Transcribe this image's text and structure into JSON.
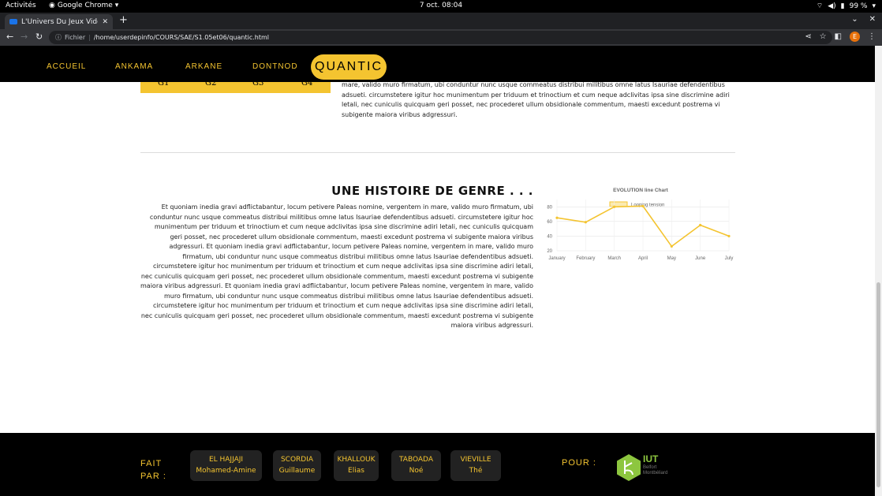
{
  "system": {
    "activities": "Activités",
    "app_name": "Google Chrome",
    "clock": "7 oct.  08:04",
    "battery": "99 %"
  },
  "browser": {
    "tab_title": "L'Univers Du Jeux Vidéo F",
    "url_prefix": "Fichier",
    "url": "/home/userdepinfo/COURS/SAE/S1.05et06/quantic.html",
    "profile_initial": "E"
  },
  "nav": {
    "items": [
      "ACCUEIL",
      "ANKAMA",
      "ARKANE",
      "DONTNOD"
    ],
    "active": "QUANTIC"
  },
  "top_table": {
    "headers": [
      "G1",
      "G2",
      "G3",
      "G4"
    ]
  },
  "top_paragraph": "mare, valido muro firmatum, ubi conduntur nunc usque commeatus distribui militibus omne latus Isauriae defendentibus adsueti. circumstetere igitur hoc munimentum per triduum et trinoctium et cum neque adclivitas ipsa sine discrimine adiri letali, nec cuniculis quicquam geri posset, nec procederet ullum obsidionale commentum, maesti excedunt postrema vi subigente maiora viribus adgressuri.",
  "section": {
    "title": "UNE HISTOIRE DE GENRE . . .",
    "paragraph": "Et quoniam inedia gravi adflictabantur, locum petivere Paleas nomine, vergentem in mare, valido muro firmatum, ubi conduntur nunc usque commeatus distribui militibus omne latus Isauriae defendentibus adsueti. circumstetere igitur hoc munimentum per triduum et trinoctium et cum neque adclivitas ipsa sine discrimine adiri letali, nec cuniculis quicquam geri posset, nec procederet ullum obsidionale commentum, maesti excedunt postrema vi subigente maiora viribus adgressuri. Et quoniam inedia gravi adflictabantur, locum petivere Paleas nomine, vergentem in mare, valido muro firmatum, ubi conduntur nunc usque commeatus distribui militibus omne latus Isauriae defendentibus adsueti. circumstetere igitur hoc munimentum per triduum et trinoctium et cum neque adclivitas ipsa sine discrimine adiri letali, nec cuniculis quicquam geri posset, nec procederet ullum obsidionale commentum, maesti excedunt postrema vi subigente maiora viribus adgressuri. Et quoniam inedia gravi adflictabantur, locum petivere Paleas nomine, vergentem in mare, valido muro firmatum, ubi conduntur nunc usque commeatus distribui militibus omne latus Isauriae defendentibus adsueti. circumstetere igitur hoc munimentum per triduum et trinoctium et cum neque adclivitas ipsa sine discrimine adiri letali, nec cuniculis quicquam geri posset, nec procederet ullum obsidionale commentum, maesti excedunt postrema vi subigente maiora viribus adgressuri."
  },
  "chart_data": {
    "type": "line",
    "title": "EVOLUTION line Chart",
    "categories": [
      "January",
      "February",
      "March",
      "April",
      "May",
      "June",
      "July"
    ],
    "series": [
      {
        "name": "Looping tension",
        "values": [
          65,
          59,
          80,
          81,
          26,
          55,
          40
        ],
        "color": "#f4c430"
      }
    ],
    "yticks": [
      20,
      40,
      60,
      80
    ],
    "ylim": [
      20,
      90
    ],
    "grid": true,
    "legend": "top"
  },
  "footer": {
    "fait_par_line1": "FAIT",
    "fait_par_line2": "PAR :",
    "authors": [
      {
        "last": "EL HAJJAJI",
        "first": "Mohamed-Amine"
      },
      {
        "last": "SCORDIA",
        "first": "Guillaume"
      },
      {
        "last": "KHALLOUK",
        "first": "Elias"
      },
      {
        "last": "TABOADA",
        "first": "Noé"
      },
      {
        "last": "VIEVILLE",
        "first": "Thé"
      }
    ],
    "pour": "POUR :",
    "logo_name": "IUT",
    "logo_sub1": "Belfort",
    "logo_sub2": "Montbéliard"
  },
  "colors": {
    "accent": "#f4c430",
    "nav_bg": "#000000"
  }
}
